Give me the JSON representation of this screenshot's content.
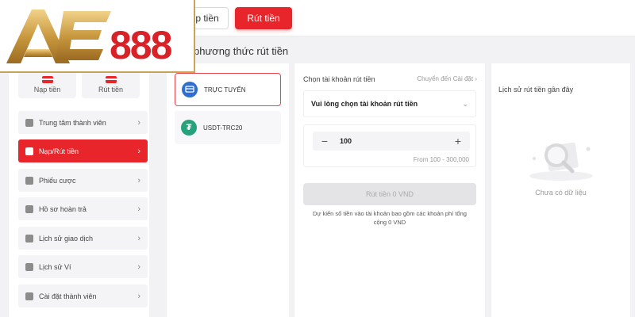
{
  "brand": {
    "logo_text": "AE888",
    "accent": "#e8252b",
    "gold": "#c9a35a"
  },
  "top_tabs": {
    "nap_label": "p tiền",
    "rut_label": "Rút tiền"
  },
  "section_title": "phương thức rút tiền",
  "quick_actions": [
    {
      "label": "Nạp tiền",
      "icon": "card-icon"
    },
    {
      "label": "Rút tiền",
      "icon": "card-icon"
    }
  ],
  "menu": [
    {
      "label": "Trung tâm thành viên",
      "icon": "diamond-icon",
      "active": false
    },
    {
      "label": "Nạp/Rút tiền",
      "icon": "wallet-icon",
      "active": true
    },
    {
      "label": "Phiếu cược",
      "icon": "ticket-icon",
      "active": false
    },
    {
      "label": "Hồ sơ hoàn trả",
      "icon": "refund-icon",
      "active": false
    },
    {
      "label": "Lịch sử giao dịch",
      "icon": "history-icon",
      "active": false
    },
    {
      "label": "Lịch sử Ví",
      "icon": "wallet-history-icon",
      "active": false
    },
    {
      "label": "Cài đặt thành viên",
      "icon": "settings-icon",
      "active": false
    }
  ],
  "methods": [
    {
      "label": "TRỰC TUYẾN",
      "icon": "online-bank-icon",
      "selected": true
    },
    {
      "label": "USDT-TRC20",
      "icon": "tether-icon",
      "selected": false
    }
  ],
  "form": {
    "account_label": "Chọn tài khoản rút tiền",
    "settings_link": "Chuyển đến Cài đặt",
    "select_placeholder": "Vui lòng chọn tài khoản rút tiền",
    "amount": "100",
    "range_text": "From 100 - 300,000",
    "submit_label": "Rút tiền 0 VND",
    "note": "Dự kiến số tiền vào tài khoản bao gồm các khoản phí tổng cộng 0 VND"
  },
  "history": {
    "title": "Lịch sử rút tiền gần đây",
    "empty_text": "Chưa có dữ liệu"
  }
}
